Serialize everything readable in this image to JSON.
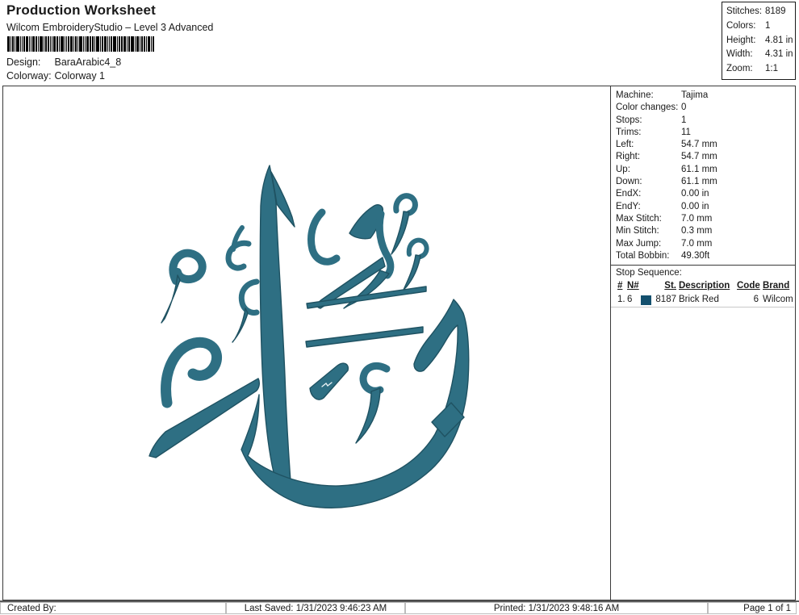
{
  "header": {
    "title": "Production Worksheet",
    "subtitle": "Wilcom EmbroideryStudio – Level 3 Advanced",
    "design_label": "Design:",
    "design_value": "BaraArabic4_8",
    "colorway_label": "Colorway:",
    "colorway_value": "Colorway 1",
    "barcode_bars": [
      3,
      1,
      2,
      1,
      4,
      1,
      1,
      2,
      3,
      1,
      1,
      3,
      2,
      1,
      4,
      1,
      2,
      2,
      1,
      1,
      3,
      2,
      1,
      4,
      1,
      1,
      2,
      3,
      1,
      2,
      1,
      4,
      1,
      1,
      3,
      2,
      2,
      1,
      4,
      1,
      2,
      3,
      1,
      1,
      2,
      4,
      1,
      2,
      2,
      3,
      1,
      2,
      4,
      1,
      3,
      1,
      2,
      2,
      1,
      3,
      1,
      2
    ]
  },
  "stats_box": {
    "rows": [
      {
        "label": "Stitches:",
        "value": "8189"
      },
      {
        "label": "Colors:",
        "value": "1"
      },
      {
        "label": "Height:",
        "value": "4.81 in"
      },
      {
        "label": "Width:",
        "value": "4.31 in"
      },
      {
        "label": "Zoom:",
        "value": "1:1"
      }
    ]
  },
  "machine_panel": {
    "rows": [
      {
        "label": "Machine:",
        "value": "Tajima"
      },
      {
        "label": "Color changes:",
        "value": "0"
      },
      {
        "label": "Stops:",
        "value": "1"
      },
      {
        "label": "Trims:",
        "value": "11"
      },
      {
        "label": "Left:",
        "value": "54.7 mm"
      },
      {
        "label": "Right:",
        "value": "54.7 mm"
      },
      {
        "label": "Up:",
        "value": "61.1 mm"
      },
      {
        "label": "Down:",
        "value": "61.1 mm"
      },
      {
        "label": "EndX:",
        "value": "0.00 in"
      },
      {
        "label": "EndY:",
        "value": "0.00 in"
      },
      {
        "label": "Max Stitch:",
        "value": "7.0 mm"
      },
      {
        "label": "Min Stitch:",
        "value": "0.3 mm"
      },
      {
        "label": "Max Jump:",
        "value": "7.0 mm"
      },
      {
        "label": "Total Bobbin:",
        "value": "49.30ft"
      }
    ]
  },
  "stop_sequence": {
    "title": "Stop Sequence:",
    "columns": [
      "#",
      "N#",
      "St.",
      "Description",
      "Code",
      "Brand"
    ],
    "rows": [
      {
        "num": "1.",
        "n": "6",
        "st": "8187",
        "description": "Brick Red",
        "code": "6",
        "brand": "Wilcom"
      }
    ]
  },
  "design_preview": {
    "description": "Arabic calligraphy 'Baraa' embroidery stitch preview",
    "colors": {
      "thread": "#2e6f83",
      "thread-dark": "#1f5262",
      "thread-light": "#4e8fa1",
      "swatch": "#14506e"
    }
  },
  "footer": {
    "created_by": "Created By:",
    "last_saved": "Last Saved: 1/31/2023 9:46:23 AM",
    "printed": "Printed: 1/31/2023 9:48:16 AM",
    "page": "Page 1 of 1"
  }
}
